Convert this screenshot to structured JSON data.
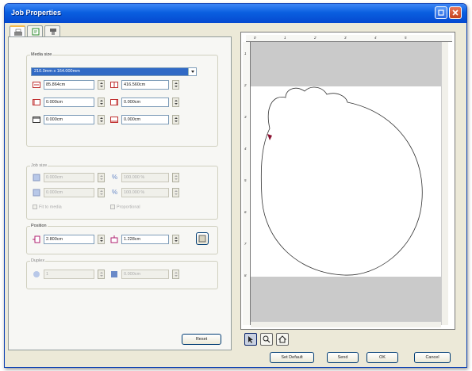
{
  "window": {
    "title": "Job Properties"
  },
  "tabs": [
    {
      "icon": "printer-icon",
      "active": true
    },
    {
      "icon": "document-icon",
      "active": false
    },
    {
      "icon": "print-queue-icon",
      "active": false
    }
  ],
  "media_size": {
    "label": "Media size",
    "selected": "210.0mm x 164.000mm",
    "width": "85.864cm",
    "height": "416.560cm",
    "margin_left": "0.000cm",
    "margin_right": "0.000cm",
    "margin_top": "0.000cm",
    "margin_bottom": "0.000cm"
  },
  "job_size": {
    "label": "Job size",
    "width": "0.000cm",
    "width_pct": "100.000 %",
    "height": "0.000cm",
    "height_pct": "100.000 %",
    "keep_ratio_label": "Fit to media",
    "proportional_label": "Proportional"
  },
  "position": {
    "label": "Position",
    "x": "2.800cm",
    "y": "1.228cm"
  },
  "duplex": {
    "label": "Duplex",
    "copies": "1",
    "gap": "0.000cm"
  },
  "buttons": {
    "reset": "Reset",
    "set_default": "Set Default",
    "send": "Send",
    "ok": "OK",
    "cancel": "Cancel"
  },
  "preview": {
    "ruler_top": [
      "0",
      "1",
      "2",
      "3",
      "4",
      "5"
    ],
    "ruler_left": [
      "1",
      "2",
      "3",
      "4",
      "5",
      "6",
      "7",
      "8"
    ]
  }
}
